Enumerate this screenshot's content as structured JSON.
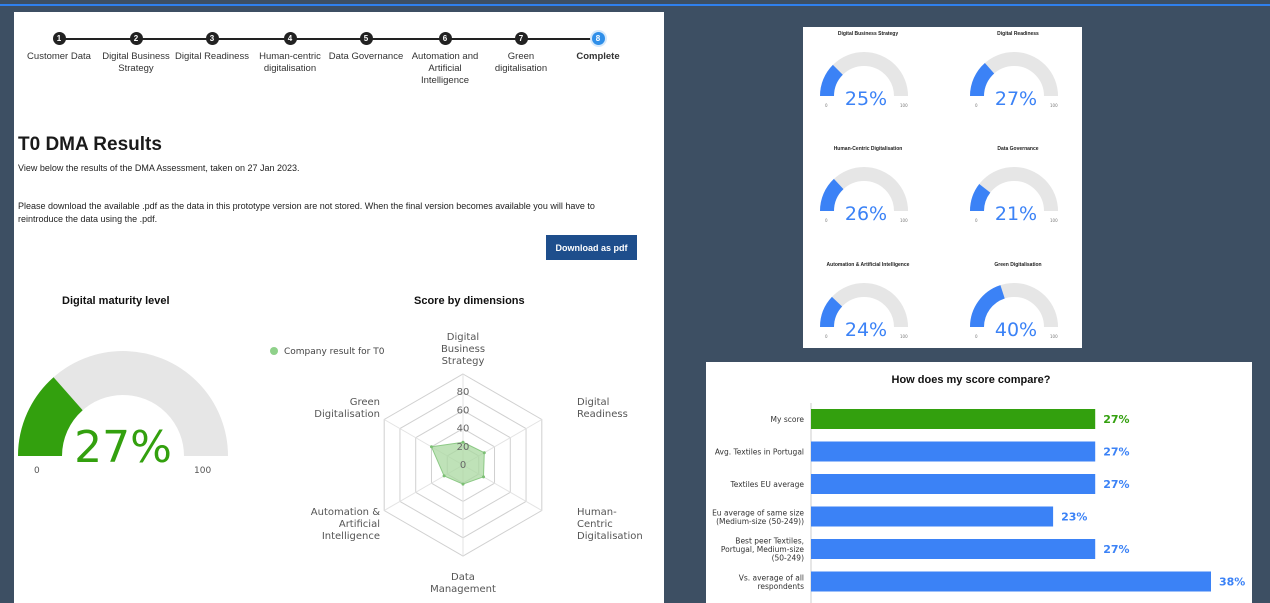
{
  "steps": [
    {
      "num": "1",
      "label": "Customer Data"
    },
    {
      "num": "2",
      "label": "Digital Business Strategy"
    },
    {
      "num": "3",
      "label": "Digital Readiness"
    },
    {
      "num": "4",
      "label": "Human-centric digitalisation"
    },
    {
      "num": "5",
      "label": "Data Governance"
    },
    {
      "num": "6",
      "label": "Automation and Artificial Intelligence"
    },
    {
      "num": "7",
      "label": "Green digitalisation"
    },
    {
      "num": "8",
      "label": "Complete"
    }
  ],
  "page": {
    "title": "T0 DMA Results",
    "intro": "View below the results of the DMA Assessment, taken on 27 Jan 2023.",
    "notice": "Please download the available .pdf as the data in this prototype version are not stored. When the final version becomes available you will have to reintroduce the data using the .pdf.",
    "download_label": "Download as pdf"
  },
  "maturity": {
    "title": "Digital maturity level",
    "value": 27,
    "value_label": "27%",
    "min_label": "0",
    "max_label": "100",
    "color": "#33a00e",
    "track_color": "#e6e6e6"
  },
  "radar": {
    "title": "Score by dimensions",
    "legend": "Company result for T0",
    "color": "#a9d8a0",
    "axes": [
      [
        "Digital",
        "Business",
        "Strategy"
      ],
      [
        "Digital",
        "Readiness"
      ],
      [
        "Human-",
        "Centric",
        "Digitalisation"
      ],
      [
        "Data",
        "Management"
      ],
      [
        "Automation &",
        "Artificial",
        "Intelligence"
      ],
      [
        "Green",
        "Digitalisation"
      ]
    ],
    "ticks": [
      "0",
      "20",
      "40",
      "60",
      "80"
    ],
    "values": [
      25,
      27,
      26,
      21,
      24,
      40
    ]
  },
  "mini_gauges": [
    {
      "title": "Digital Business Strategy",
      "value": 25,
      "label": "25%"
    },
    {
      "title": "Digital Readiness",
      "value": 27,
      "label": "27%"
    },
    {
      "title": "Human-Centric Digitalisation",
      "value": 26,
      "label": "26%"
    },
    {
      "title": "Data Governance",
      "value": 21,
      "label": "21%"
    },
    {
      "title": "Automation & Artificial Intelligence",
      "value": 24,
      "label": "24%"
    },
    {
      "title": "Green Digitalisation",
      "value": 40,
      "label": "40%"
    }
  ],
  "mini_axis": {
    "min": "0",
    "max": "100"
  },
  "chart_data": {
    "type": "bar",
    "title": "How does my score compare?",
    "categories": [
      [
        "My score"
      ],
      [
        "Avg. Textiles in Portugal"
      ],
      [
        "Textiles EU average"
      ],
      [
        "Eu average of same size",
        "(Medium-size (50-249))"
      ],
      [
        "Best peer Textiles,",
        "Portugal, Medium-size",
        "(50-249)"
      ],
      [
        "Vs. average of all",
        "respondents"
      ]
    ],
    "values": [
      27,
      27,
      27,
      23,
      27,
      38
    ],
    "value_labels": [
      "27%",
      "27%",
      "27%",
      "23%",
      "27%",
      "38%"
    ],
    "colors": [
      "#33a00e",
      "#3b82f6",
      "#3b82f6",
      "#3b82f6",
      "#3b82f6",
      "#3b82f6"
    ],
    "xlim": [
      0,
      38
    ]
  },
  "colors": {
    "accent": "#2f80ed",
    "gauge_blue": "#3b82f6",
    "button": "#1e4e8c"
  }
}
